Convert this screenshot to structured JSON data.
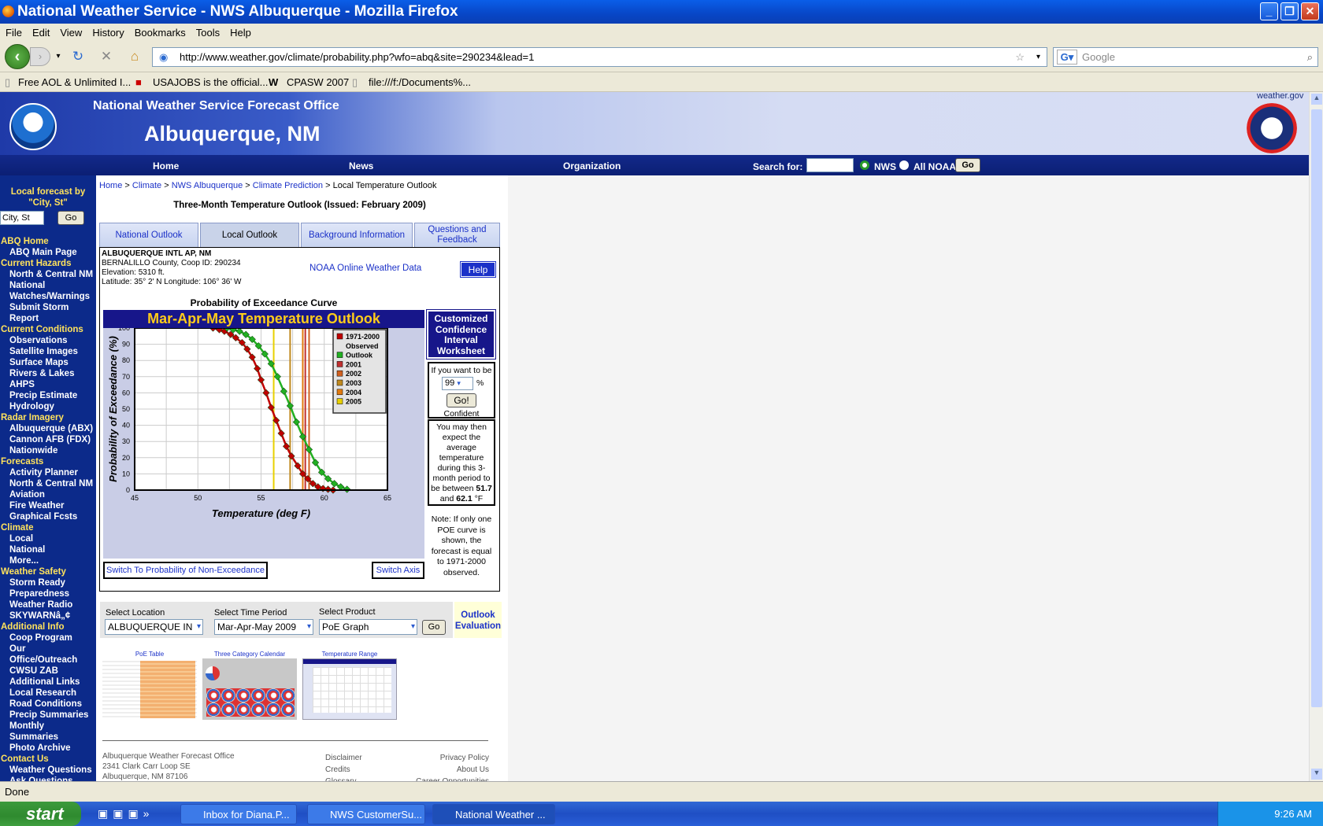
{
  "window": {
    "title": "National Weather Service - NWS Albuquerque - Mozilla Firefox"
  },
  "menu": [
    "File",
    "Edit",
    "View",
    "History",
    "Bookmarks",
    "Tools",
    "Help"
  ],
  "url": "http://www.weather.gov/climate/probability.php?wfo=abq&site=290234&lead=1",
  "search_placeholder": "Google",
  "bookmarks": [
    "Free AOL & Unlimited I...",
    "USAJOBS is the official...",
    "CPASW 2007",
    "file:///f:/Documents%..."
  ],
  "header": {
    "office": "National Weather Service Forecast Office",
    "city": "Albuquerque, NM",
    "site": "weather.gov"
  },
  "nav": {
    "home": "Home",
    "news": "News",
    "org": "Organization",
    "search_for": "Search for:",
    "opt1": "NWS",
    "opt2": "All NOAA",
    "go": "Go"
  },
  "left": {
    "local_label": "Local forecast by \"City, St\"",
    "city_value": "City, St",
    "go": "Go",
    "items": [
      [
        "s",
        "ABQ Home"
      ],
      [
        "i",
        "ABQ Main Page"
      ],
      [
        "s",
        "Current Hazards"
      ],
      [
        "i",
        "North & Central NM"
      ],
      [
        "i",
        "National"
      ],
      [
        "i",
        "Watches/Warnings"
      ],
      [
        "i",
        "Submit Storm"
      ],
      [
        "i",
        "Report"
      ],
      [
        "s",
        "Current Conditions"
      ],
      [
        "i",
        "Observations"
      ],
      [
        "i",
        "Satellite Images"
      ],
      [
        "i",
        "Surface Maps"
      ],
      [
        "i",
        "Rivers & Lakes"
      ],
      [
        "i",
        "AHPS"
      ],
      [
        "i",
        "Precip Estimate"
      ],
      [
        "i",
        "Hydrology"
      ],
      [
        "s",
        "Radar Imagery"
      ],
      [
        "i",
        "Albuquerque (ABX)"
      ],
      [
        "i",
        "Cannon AFB (FDX)"
      ],
      [
        "i",
        "Nationwide"
      ],
      [
        "s",
        "Forecasts"
      ],
      [
        "i",
        "Activity Planner"
      ],
      [
        "i",
        "North & Central NM"
      ],
      [
        "i",
        "Aviation"
      ],
      [
        "i",
        "Fire Weather"
      ],
      [
        "i",
        "Graphical Fcsts"
      ],
      [
        "s",
        "Climate"
      ],
      [
        "i",
        "Local"
      ],
      [
        "i",
        "National"
      ],
      [
        "i",
        "More..."
      ],
      [
        "s",
        "Weather Safety"
      ],
      [
        "i",
        "Storm Ready"
      ],
      [
        "i",
        "Preparedness"
      ],
      [
        "i",
        "Weather Radio"
      ],
      [
        "i",
        "SKYWARNâ„¢"
      ],
      [
        "s",
        "Additional Info"
      ],
      [
        "i",
        "Coop Program"
      ],
      [
        "i",
        "Our"
      ],
      [
        "i",
        "Office/Outreach"
      ],
      [
        "i",
        "CWSU ZAB"
      ],
      [
        "i",
        "Additional Links"
      ],
      [
        "i",
        "Local Research"
      ],
      [
        "i",
        "Road Conditions"
      ],
      [
        "i",
        "Precip Summaries"
      ],
      [
        "i",
        "Monthly"
      ],
      [
        "i",
        "Summaries"
      ],
      [
        "i",
        "Photo Archive"
      ],
      [
        "s",
        "Contact Us"
      ],
      [
        "i",
        "Weather Questions"
      ],
      [
        "i",
        "Ask Questions"
      ]
    ]
  },
  "breadcrumb": {
    "home": "Home",
    "climate": "Climate",
    "abq": "NWS Albuquerque",
    "cp": "Climate Prediction",
    "sep": " > ",
    "cur": "Local Temperature Outlook"
  },
  "page_title": "Three-Month Temperature Outlook (Issued: February 2009)",
  "tabs": [
    "National Outlook",
    "Local Outlook",
    "Background Information",
    "Questions and Feedback"
  ],
  "station": {
    "name": "ALBUQUERQUE INTL AP, NM",
    "county": "BERNALILLO County, Coop ID: 290234",
    "elev": "Elevation: 5310 ft.",
    "latlon": "Latitude: 35° 2' N Longitude: 106° 36' W",
    "noaa_link": "NOAA Online Weather Data",
    "help": "Help"
  },
  "chart_title": "Probability of Exceedance Curve",
  "chart_banner": "Mar-Apr-May Temperature Outlook",
  "chart_data": {
    "type": "line",
    "xlabel": "Temperature (deg F)",
    "ylabel": "Probability of Exceedance (%)",
    "xlim": [
      45,
      65
    ],
    "ylim": [
      0,
      100
    ],
    "xticks": [
      "45",
      "50",
      "55",
      "60",
      "65"
    ],
    "yticks": [
      "0",
      "10",
      "20",
      "30",
      "40",
      "50",
      "60",
      "70",
      "80",
      "90",
      "100"
    ],
    "series": [
      {
        "name": "1971-2000 Observed",
        "color": "#c00000",
        "x": [
          51.2,
          51.7,
          52.1,
          52.6,
          53.0,
          53.5,
          53.9,
          54.3,
          54.7,
          55.0,
          55.4,
          55.8,
          56.2,
          56.6,
          57.0,
          57.4,
          57.9,
          58.3,
          58.7,
          59.1,
          59.5,
          59.9,
          60.3,
          60.7
        ],
        "y": [
          100,
          99,
          98,
          96,
          94,
          91,
          87,
          82,
          75,
          68,
          60,
          51,
          43,
          35,
          27,
          21,
          15,
          10,
          7,
          4,
          2,
          1,
          0.5,
          0
        ]
      },
      {
        "name": "Outlook",
        "color": "#22b022",
        "x": [
          52.3,
          52.8,
          53.3,
          53.8,
          54.3,
          54.8,
          55.3,
          55.8,
          56.3,
          56.8,
          57.3,
          57.8,
          58.3,
          58.8,
          59.3,
          59.8,
          60.3,
          60.8,
          61.3,
          61.8
        ],
        "y": [
          100,
          99,
          98,
          96,
          93,
          89,
          84,
          78,
          70,
          61,
          52,
          42,
          33,
          25,
          17,
          11,
          7,
          4,
          2,
          0.5
        ]
      }
    ],
    "vlines": [
      {
        "name": "2001",
        "x": 58.5,
        "color": "#c03030"
      },
      {
        "name": "2002",
        "x": 58.8,
        "color": "#d06020"
      },
      {
        "name": "2003",
        "x": 57.3,
        "color": "#c08a20"
      },
      {
        "name": "2004",
        "x": 58.3,
        "color": "#e07a10"
      },
      {
        "name": "2005",
        "x": 56.0,
        "color": "#e8d000"
      }
    ],
    "legend": [
      "1971-2000",
      "Observed",
      "Outlook",
      "2001",
      "2002",
      "2003",
      "2004",
      "2005"
    ]
  },
  "worksheet": {
    "title": "Customized Confidence Interval Worksheet",
    "want": "If you want to be",
    "conf_value": "99",
    "pct": "%",
    "go": "Go!",
    "confident": "Confident",
    "result_pre": "You may then expect the average temperature during this 3-month period to be between",
    "low": "51.7",
    "and": "and",
    "high": "62.1",
    "unit": "°F",
    "note": "Note: If only one POE curve is shown, the forecast is equal to 1971-2000 observed."
  },
  "switch": {
    "nonexc": "Switch To Probability of Non-Exceedance",
    "axis": "Switch Axis"
  },
  "selectors": {
    "loc_label": "Select Location",
    "loc": "ALBUQUERQUE IN",
    "period_label": "Select Time Period",
    "period": "Mar-Apr-May 2009",
    "product_label": "Select Product",
    "product": "PoE Graph",
    "go": "Go",
    "eval": "Outlook Evaluation"
  },
  "thumbs": [
    "PoE Table",
    "Three Category Calendar",
    "Temperature Range"
  ],
  "footer": {
    "addr1": "Albuquerque Weather Forecast Office",
    "addr2": "2341 Clark Carr Loop SE",
    "addr3": "Albuquerque, NM 87106",
    "l1": "Disclaimer",
    "l2": "Credits",
    "l3": "Glossary",
    "r1": "Privacy Policy",
    "r2": "About Us",
    "r3": "Career Opportunities"
  },
  "status": "Done",
  "taskbar": {
    "start": "start",
    "t1": "Inbox for Diana.P...",
    "t2": "NWS CustomerSu...",
    "t3": "National Weather ...",
    "time": "9:26 AM"
  }
}
